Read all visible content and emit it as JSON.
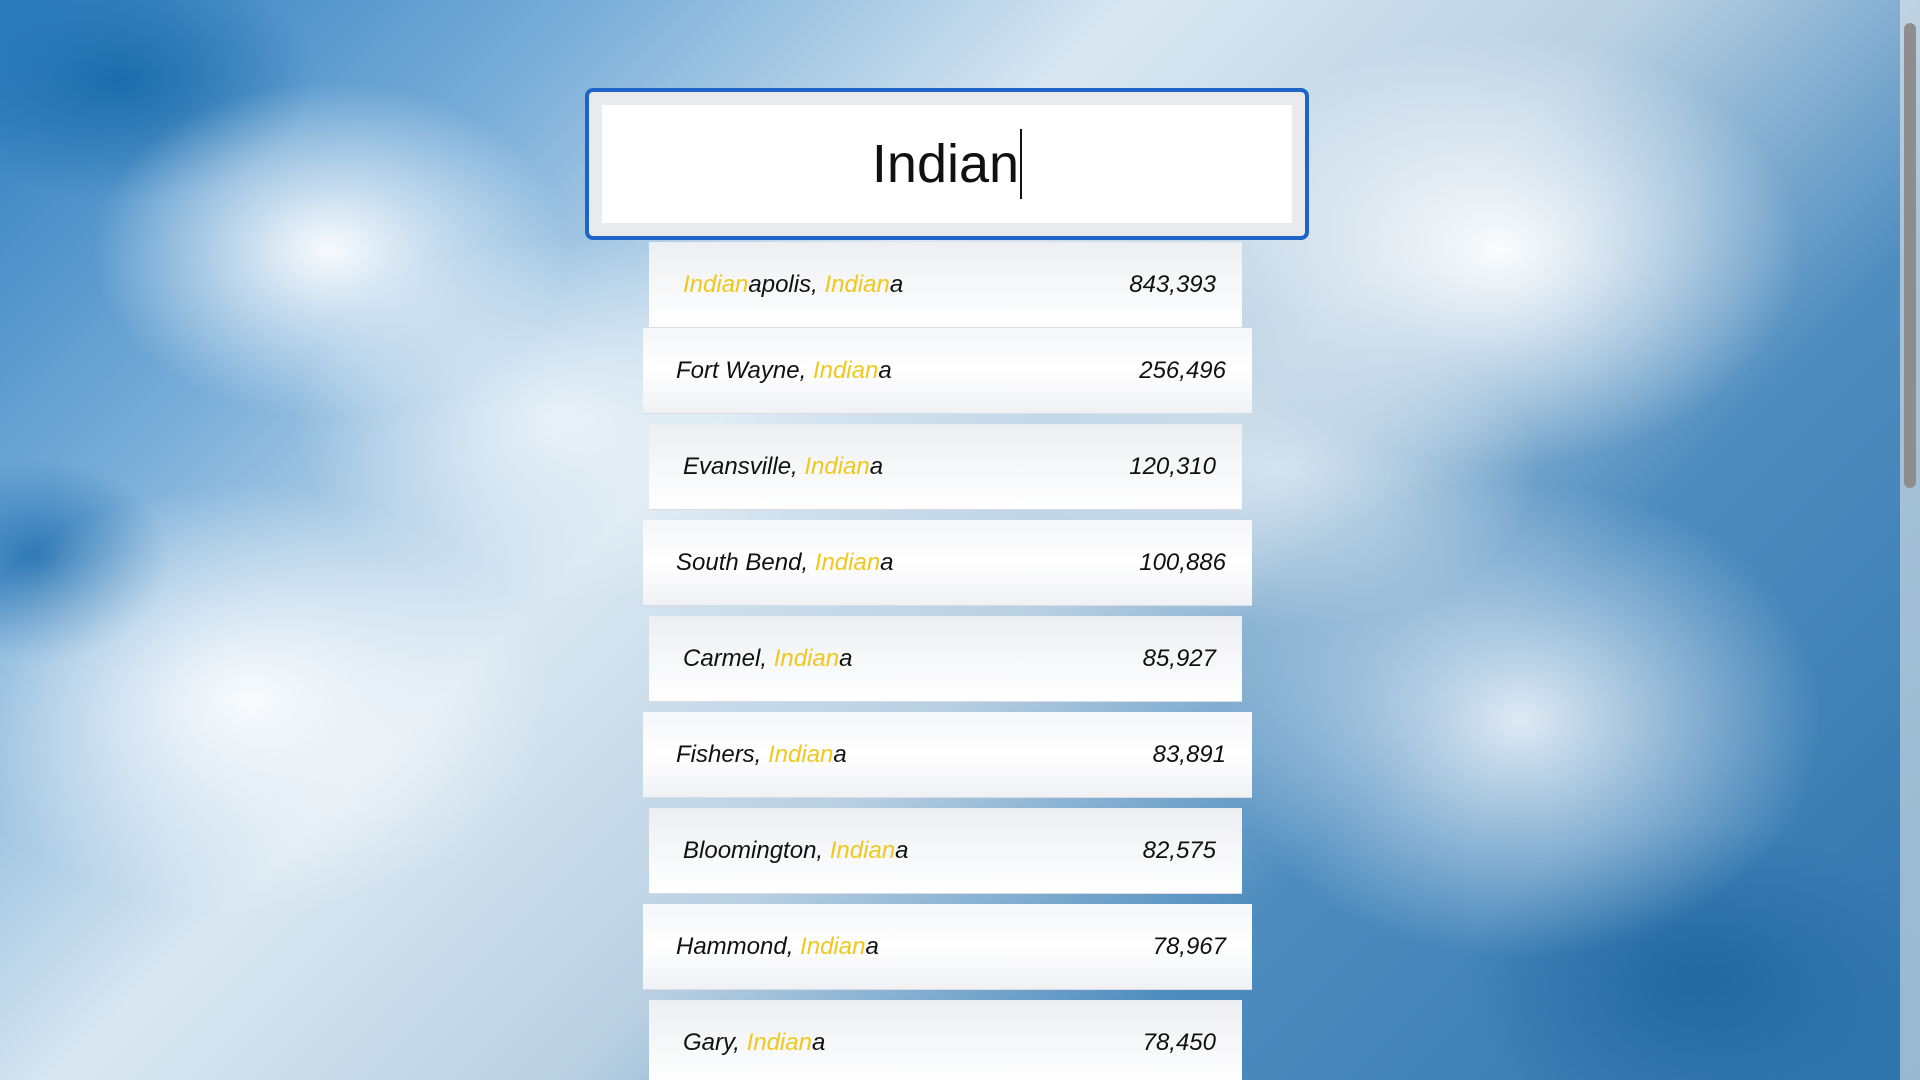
{
  "search": {
    "value": "Indian"
  },
  "results": [
    {
      "city_prefix": "Indian",
      "city_suffix": "apolis, ",
      "state_prefix": "Indian",
      "state_suffix": "a",
      "value": "843,393"
    },
    {
      "city_prefix": "",
      "city_suffix": "Fort Wayne, ",
      "state_prefix": "Indian",
      "state_suffix": "a",
      "value": "256,496"
    },
    {
      "city_prefix": "",
      "city_suffix": "Evansville, ",
      "state_prefix": "Indian",
      "state_suffix": "a",
      "value": "120,310"
    },
    {
      "city_prefix": "",
      "city_suffix": "South Bend, ",
      "state_prefix": "Indian",
      "state_suffix": "a",
      "value": "100,886"
    },
    {
      "city_prefix": "",
      "city_suffix": "Carmel, ",
      "state_prefix": "Indian",
      "state_suffix": "a",
      "value": "85,927"
    },
    {
      "city_prefix": "",
      "city_suffix": "Fishers, ",
      "state_prefix": "Indian",
      "state_suffix": "a",
      "value": "83,891"
    },
    {
      "city_prefix": "",
      "city_suffix": "Bloomington, ",
      "state_prefix": "Indian",
      "state_suffix": "a",
      "value": "82,575"
    },
    {
      "city_prefix": "",
      "city_suffix": "Hammond, ",
      "state_prefix": "Indian",
      "state_suffix": "a",
      "value": "78,967"
    },
    {
      "city_prefix": "",
      "city_suffix": "Gary, ",
      "state_prefix": "Indian",
      "state_suffix": "a",
      "value": "78,450"
    }
  ],
  "colors": {
    "highlight": "#f0c81d",
    "accent": "#1d64c7"
  }
}
